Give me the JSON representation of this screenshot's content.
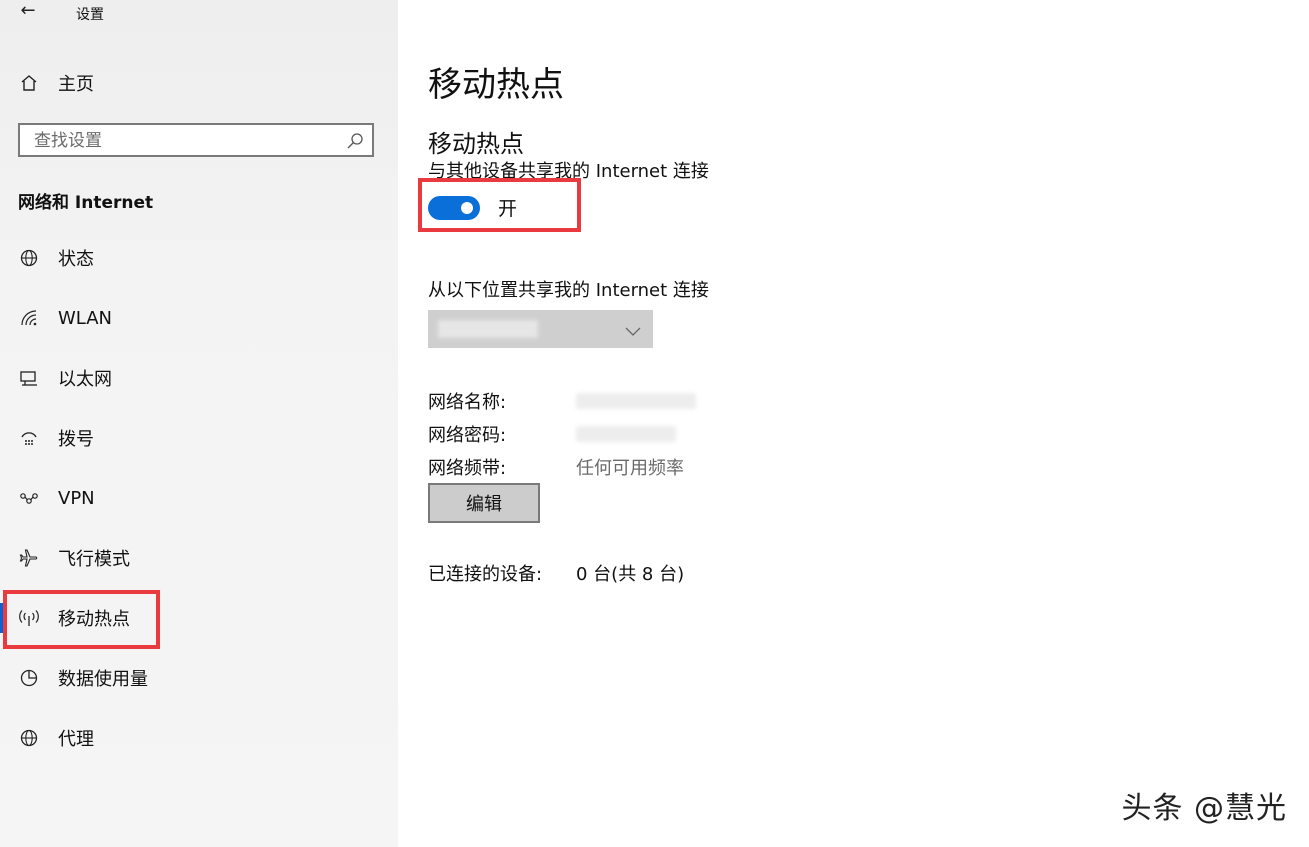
{
  "window": {
    "title": "设置",
    "back_glyph": "←"
  },
  "sidebar": {
    "home_label": "主页",
    "search_placeholder": "查找设置",
    "section_header": "网络和 Internet",
    "items": [
      {
        "label": "状态",
        "icon": "globe-status-icon"
      },
      {
        "label": "WLAN",
        "icon": "wifi-icon"
      },
      {
        "label": "以太网",
        "icon": "ethernet-icon"
      },
      {
        "label": "拨号",
        "icon": "dialup-icon"
      },
      {
        "label": "VPN",
        "icon": "vpn-icon"
      },
      {
        "label": "飞行模式",
        "icon": "airplane-icon"
      },
      {
        "label": "移动热点",
        "icon": "hotspot-icon",
        "selected": true
      },
      {
        "label": "数据使用量",
        "icon": "data-usage-icon"
      },
      {
        "label": "代理",
        "icon": "globe-proxy-icon"
      }
    ]
  },
  "main": {
    "page_title": "移动热点",
    "sub_title": "移动热点",
    "share_desc": "与其他设备共享我的 Internet 连接",
    "toggle_state": "开",
    "toggle_on": true,
    "from_label": "从以下位置共享我的 Internet 连接",
    "network_name_label": "网络名称:",
    "network_password_label": "网络密码:",
    "network_band_label": "网络频带:",
    "network_band_value": "任何可用频率",
    "edit_label": "编辑",
    "connected_label": "已连接的设备:",
    "connected_value": "0 台(共 8 台)"
  },
  "watermark": "头条 @慧光",
  "colors": {
    "accent": "#0a6fd8",
    "highlight": "#e83a3f",
    "sidebar_bg": "#f3f3f3"
  }
}
